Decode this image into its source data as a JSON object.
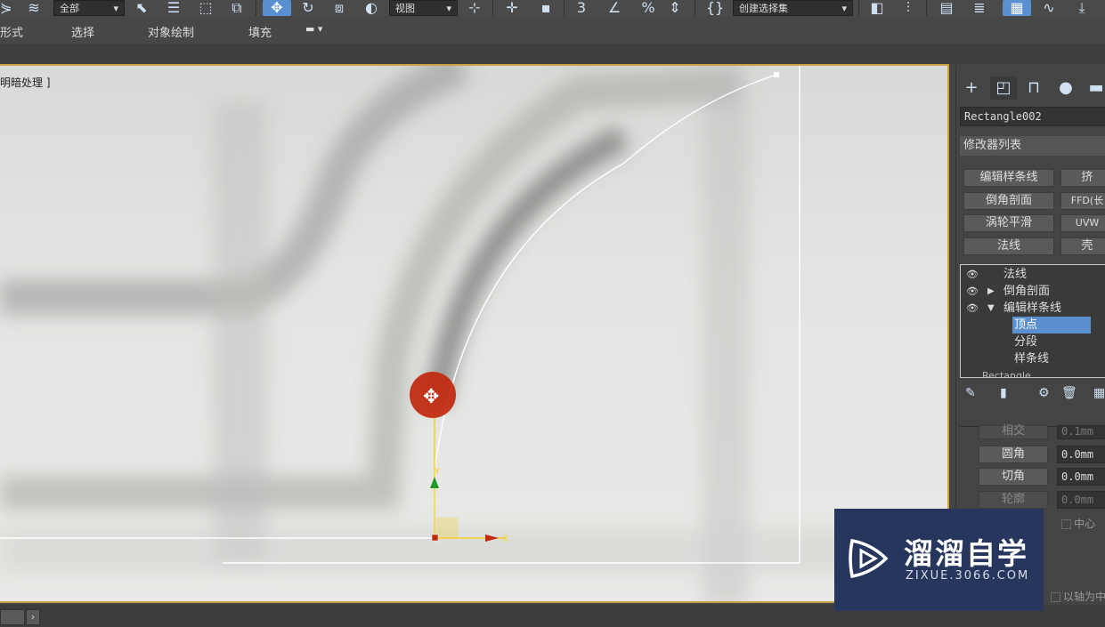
{
  "toolbar": {
    "filter_value": "全部",
    "view_value": "视图",
    "selection_set_placeholder": "创建选择集",
    "snap_value": "3"
  },
  "ribbon": {
    "tabs": [
      "形式",
      "选择",
      "对象绘制",
      "填充"
    ]
  },
  "viewport": {
    "label": "明暗处理 ]"
  },
  "command_panel": {
    "object_name": "Rectangle002",
    "modifier_list": "修改器列表",
    "modifier_buttons": [
      "编辑样条线",
      "挤",
      "倒角剖面",
      "FFD(长",
      "涡轮平滑",
      "UVW",
      "法线",
      "壳"
    ],
    "stack": {
      "items": [
        "法线",
        "倒角剖面",
        "编辑样条线"
      ],
      "subobjects": [
        "顶点",
        "分段",
        "样条线"
      ],
      "clipped_item": "Rectangle"
    },
    "properties": {
      "partial_label": "相交",
      "partial_value": "0.1mm",
      "fillet_label": "圆角",
      "fillet_value": "0.0mm",
      "chamfer_label": "切角",
      "chamfer_value": "0.0mm",
      "outline_label": "轮廓",
      "outline_value": "0.0mm",
      "center_label": "中心",
      "axis_label": "以轴为中"
    }
  },
  "watermark": {
    "title": "溜溜自学",
    "url": "ZIXUE.3066.COM"
  },
  "colors": {
    "accent": "#5a8fd0",
    "viewport_border": "#c9a34a",
    "gizmo_red": "#c0280e",
    "gizmo_yellow": "#f2d22e",
    "watermark_bg": "#26365c"
  }
}
